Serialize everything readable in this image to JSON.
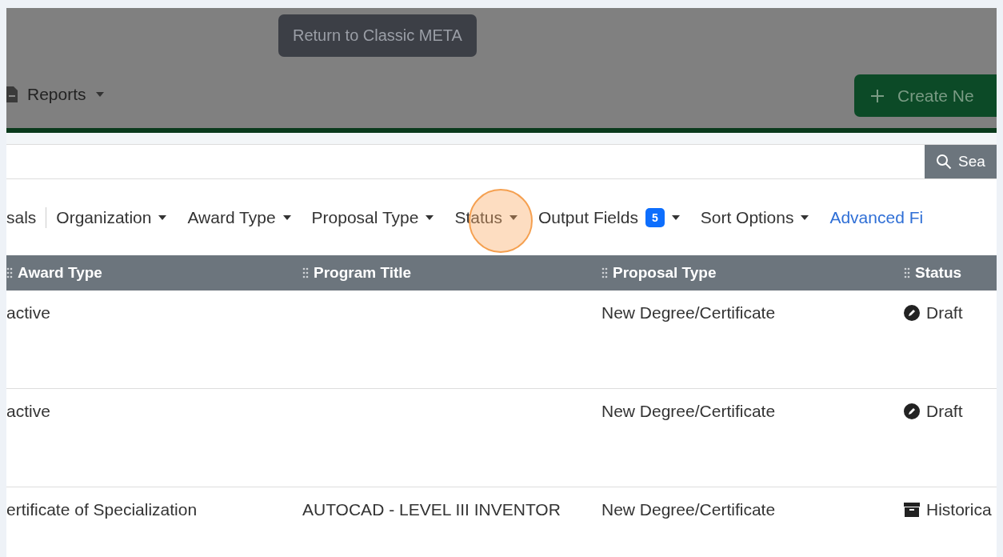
{
  "header": {
    "return_button": "Return to Classic META",
    "reports_menu": "Reports",
    "create_button": "Create Ne"
  },
  "search": {
    "button": "Sea"
  },
  "filters": [
    {
      "kind": "text",
      "label": "sals"
    },
    {
      "kind": "dropdown",
      "label": "Organization"
    },
    {
      "kind": "dropdown",
      "label": "Award Type"
    },
    {
      "kind": "dropdown",
      "label": "Proposal Type"
    },
    {
      "kind": "dropdown",
      "label": "Status"
    },
    {
      "kind": "dropdown",
      "label": "Output Fields",
      "badge": "5"
    },
    {
      "kind": "dropdown",
      "label": "Sort Options"
    },
    {
      "kind": "link",
      "label": "Advanced Fi"
    }
  ],
  "table": {
    "columns": [
      "Award Type",
      "Program Title",
      "Proposal Type",
      "Status"
    ],
    "rows": [
      {
        "award_type": "active",
        "program_title": "",
        "proposal_type": "New Degree/Certificate",
        "status": {
          "kind": "draft",
          "label": "Draft"
        }
      },
      {
        "award_type": "active",
        "program_title": "",
        "proposal_type": "New Degree/Certificate",
        "status": {
          "kind": "draft",
          "label": "Draft"
        }
      },
      {
        "award_type": "ertificate of Specialization",
        "program_title": "AUTOCAD - LEVEL III INVENTOR",
        "proposal_type": "New Degree/Certificate",
        "status": {
          "kind": "historical",
          "label": "Historica"
        }
      }
    ]
  }
}
